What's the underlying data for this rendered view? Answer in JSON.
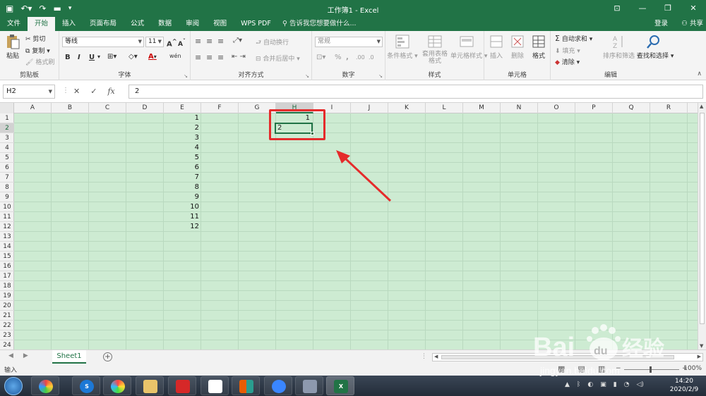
{
  "window": {
    "title": "工作簿1 - Excel",
    "qat_icons": [
      "save-icon",
      "undo-icon",
      "redo-icon",
      "folder-icon",
      "customize-icon"
    ]
  },
  "tabs": [
    "文件",
    "开始",
    "插入",
    "页面布局",
    "公式",
    "数据",
    "审阅",
    "视图",
    "WPS PDF"
  ],
  "active_tab": "开始",
  "tellme": "告诉我您想要做什么...",
  "login": "登录",
  "share": "共享",
  "ribbon": {
    "clipboard": {
      "label": "剪贴板",
      "paste": "粘贴",
      "cut": "剪切",
      "copy": "复制",
      "format_painter": "格式刷"
    },
    "font": {
      "label": "字体",
      "name": "等线",
      "size": "11",
      "bold": "B",
      "italic": "I",
      "underline": "U",
      "grow": "A",
      "shrink": "A",
      "color": "A",
      "phonetic": "wén"
    },
    "alignment": {
      "label": "对齐方式",
      "wrap": "自动换行",
      "merge": "合并后居中"
    },
    "number": {
      "label": "数字",
      "format": "常规",
      "percent": "%",
      "comma": ","
    },
    "styles": {
      "label": "样式",
      "conditional": "条件格式",
      "table": "套用表格格式",
      "cell_styles": "单元格样式"
    },
    "cells": {
      "label": "单元格",
      "insert": "插入",
      "delete": "删除",
      "format": "格式"
    },
    "editing": {
      "label": "编辑",
      "autosum": "自动求和",
      "fill": "填充",
      "clear": "清除",
      "sort": "排序和筛选",
      "find": "查找和选择"
    }
  },
  "formula_bar": {
    "name_box": "H2",
    "fx": "fx",
    "value": "2"
  },
  "columns": [
    "A",
    "B",
    "C",
    "D",
    "E",
    "F",
    "G",
    "H",
    "I",
    "J",
    "K",
    "L",
    "M",
    "N",
    "O",
    "P",
    "Q",
    "R"
  ],
  "rows": [
    "1",
    "2",
    "3",
    "4",
    "5",
    "6",
    "7",
    "8",
    "9",
    "10",
    "11",
    "12",
    "13",
    "14",
    "15",
    "16",
    "17",
    "18",
    "19",
    "20",
    "21",
    "22",
    "23",
    "24"
  ],
  "selected": {
    "col": "H",
    "row": "2"
  },
  "column_e_values": [
    "1",
    "2",
    "3",
    "4",
    "5",
    "6",
    "7",
    "8",
    "9",
    "10",
    "11",
    "12"
  ],
  "h1_value": "1",
  "active_cell_value": "2",
  "sheet_tab": "Sheet1",
  "status": {
    "mode": "输入",
    "zoom": "100%"
  },
  "taskbar": {
    "time": "14:20",
    "date": "2020/2/9"
  },
  "watermark": {
    "brand": "Bai",
    "paw": "du",
    "cn": "经验",
    "url": "jingyan.baidu.com"
  },
  "colors": {
    "excel_green": "#217346",
    "sheet_bg": "#cdebd2",
    "annotation_red": "#e52b2b"
  }
}
